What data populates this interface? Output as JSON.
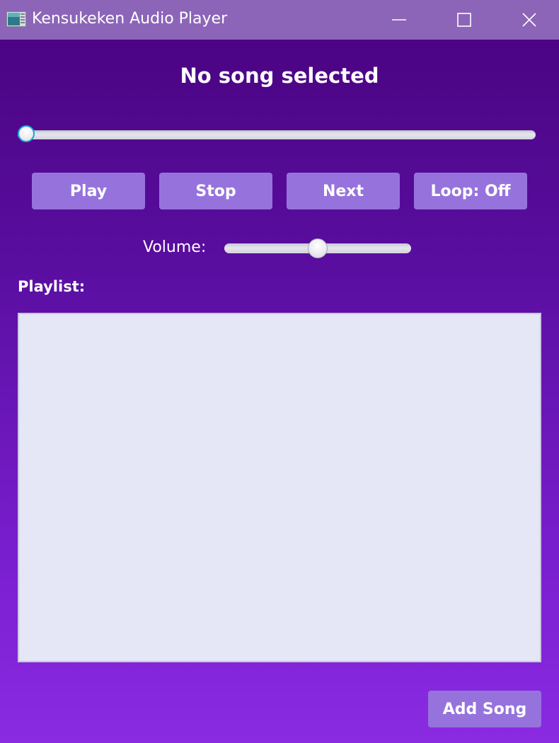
{
  "window": {
    "title": "Kensukeken Audio Player",
    "controls": {
      "minimize_icon": "minimize-icon",
      "maximize_icon": "maximize-icon",
      "close_icon": "close-icon"
    }
  },
  "player": {
    "song_title": "No song selected",
    "progress": 0,
    "buttons": {
      "play": "Play",
      "stop": "Stop",
      "next": "Next",
      "loop": "Loop: Off"
    },
    "volume": {
      "label": "Volume:",
      "level": 0.5
    }
  },
  "playlist": {
    "label": "Playlist:",
    "items": []
  },
  "add_song_label": "Add Song",
  "colors": {
    "titlebar": "#8c65b8",
    "background_top": "#4b0483",
    "background_bottom": "#8a2be2",
    "button": "#9673dc",
    "playlist_background": "#e5e6f6",
    "slider_accent": "#1aa6d6"
  }
}
